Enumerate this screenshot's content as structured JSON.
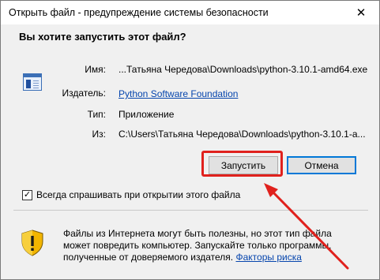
{
  "window": {
    "title": "Открыть файл - предупреждение системы безопасности",
    "close_glyph": "✕"
  },
  "question": "Вы хотите запустить этот файл?",
  "file_icon": "exe-file-icon",
  "details": {
    "name_label": "Имя:",
    "name_value": "...Татьяна Чередова\\Downloads\\python-3.10.1-amd64.exe",
    "publisher_label": "Издатель:",
    "publisher_value": "Python Software Foundation",
    "type_label": "Тип:",
    "type_value": "Приложение",
    "from_label": "Из:",
    "from_value": "C:\\Users\\Татьяна Чередова\\Downloads\\python-3.10.1-a..."
  },
  "buttons": {
    "run_label": "Запустить",
    "cancel_label": "Отмена"
  },
  "checkbox": {
    "label": "Всегда спрашивать при открытии этого файла",
    "checked": true,
    "mark": "✓"
  },
  "warning": {
    "text": "Файлы из Интернета могут быть полезны, но этот тип файла может повредить компьютер. Запускайте только программы, полученные от доверяемого издателя.",
    "link": "Факторы риска"
  },
  "colors": {
    "highlight": "#e0211d",
    "link": "#0645ad",
    "accent": "#0078d7"
  }
}
